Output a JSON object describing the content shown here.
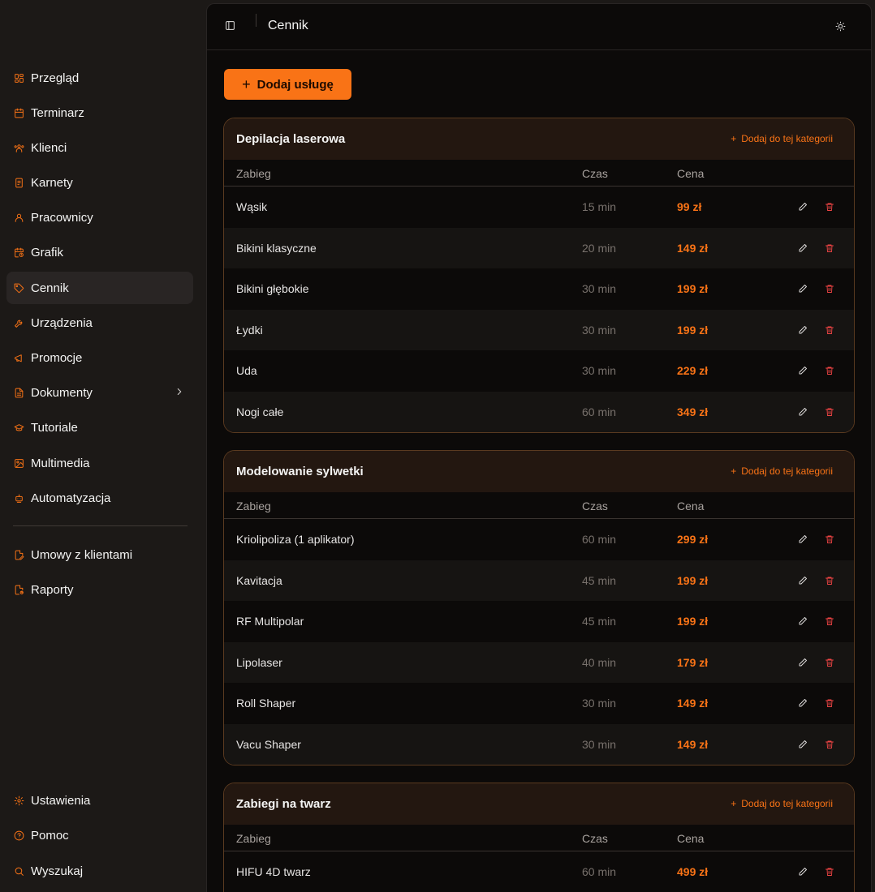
{
  "sidebar": {
    "items": [
      {
        "label": "Przegląd",
        "icon": "grid-icon"
      },
      {
        "label": "Terminarz",
        "icon": "calendar-icon"
      },
      {
        "label": "Klienci",
        "icon": "users-icon"
      },
      {
        "label": "Karnety",
        "icon": "ticket-icon"
      },
      {
        "label": "Pracownicy",
        "icon": "user-icon"
      },
      {
        "label": "Grafik",
        "icon": "calendar-clock-icon"
      },
      {
        "label": "Cennik",
        "icon": "tag-icon"
      },
      {
        "label": "Urządzenia",
        "icon": "wrench-icon"
      },
      {
        "label": "Promocje",
        "icon": "megaphone-icon"
      },
      {
        "label": "Dokumenty",
        "icon": "document-icon"
      },
      {
        "label": "Tutoriale",
        "icon": "graduation-cap-icon"
      },
      {
        "label": "Multimedia",
        "icon": "image-icon"
      },
      {
        "label": "Automatyzacja",
        "icon": "bot-icon"
      }
    ],
    "secondary": [
      {
        "label": "Umowy z klientami",
        "icon": "contract-icon"
      },
      {
        "label": "Raporty",
        "icon": "report-icon"
      }
    ],
    "footer": [
      {
        "label": "Ustawienia",
        "icon": "gear-icon"
      },
      {
        "label": "Pomoc",
        "icon": "help-icon"
      },
      {
        "label": "Wyszukaj",
        "icon": "search-icon"
      }
    ],
    "active": "Cennik"
  },
  "header": {
    "title": "Cennik"
  },
  "toolbar": {
    "add_label": "Dodaj usługę"
  },
  "table_headers": {
    "service": "Zabieg",
    "time": "Czas",
    "price": "Cena"
  },
  "categories": [
    {
      "title": "Depilacja laserowa",
      "add_label": "Dodaj do tej kategorii",
      "rows": [
        {
          "name": "Wąsik",
          "time": "15 min",
          "price": "99 zł"
        },
        {
          "name": "Bikini klasyczne",
          "time": "20 min",
          "price": "149 zł"
        },
        {
          "name": "Bikini głębokie",
          "time": "30 min",
          "price": "199 zł"
        },
        {
          "name": "Łydki",
          "time": "30 min",
          "price": "199 zł"
        },
        {
          "name": "Uda",
          "time": "30 min",
          "price": "229 zł"
        },
        {
          "name": "Nogi całe",
          "time": "60 min",
          "price": "349 zł"
        }
      ]
    },
    {
      "title": "Modelowanie sylwetki",
      "add_label": "Dodaj do tej kategorii",
      "rows": [
        {
          "name": "Kriolipoliza (1 aplikator)",
          "time": "60 min",
          "price": "299 zł"
        },
        {
          "name": "Kavitacja",
          "time": "45 min",
          "price": "199 zł"
        },
        {
          "name": "RF Multipolar",
          "time": "45 min",
          "price": "199 zł"
        },
        {
          "name": "Lipolaser",
          "time": "40 min",
          "price": "179 zł"
        },
        {
          "name": "Roll Shaper",
          "time": "30 min",
          "price": "149 zł"
        },
        {
          "name": "Vacu Shaper",
          "time": "30 min",
          "price": "149 zł"
        }
      ]
    },
    {
      "title": "Zabiegi na twarz",
      "add_label": "Dodaj do tej kategorii",
      "rows": [
        {
          "name": "HIFU 4D twarz",
          "time": "60 min",
          "price": "499 zł"
        }
      ]
    }
  ],
  "colors": {
    "accent": "#f97316",
    "danger": "#ef4444",
    "background": "#0c0a09",
    "sidebar": "#1c1917"
  }
}
